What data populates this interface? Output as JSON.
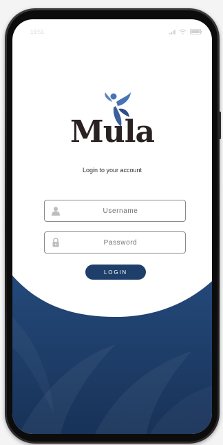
{
  "status_bar": {
    "time": "19:51",
    "icons": [
      "signal-icon",
      "wifi-icon",
      "battery-icon"
    ]
  },
  "brand": {
    "name": "Mula"
  },
  "login": {
    "subtitle": "Login to  your account",
    "username_placeholder": "Username",
    "username_value": "",
    "password_placeholder": "Password",
    "password_value": "",
    "button_label": "LOGIN"
  },
  "colors": {
    "brand_dark": "#2a2222",
    "accent_blue": "#4a73b5",
    "navy": "#1f3f6b",
    "wave_top": "#24497a",
    "wave_bottom": "#183258"
  }
}
